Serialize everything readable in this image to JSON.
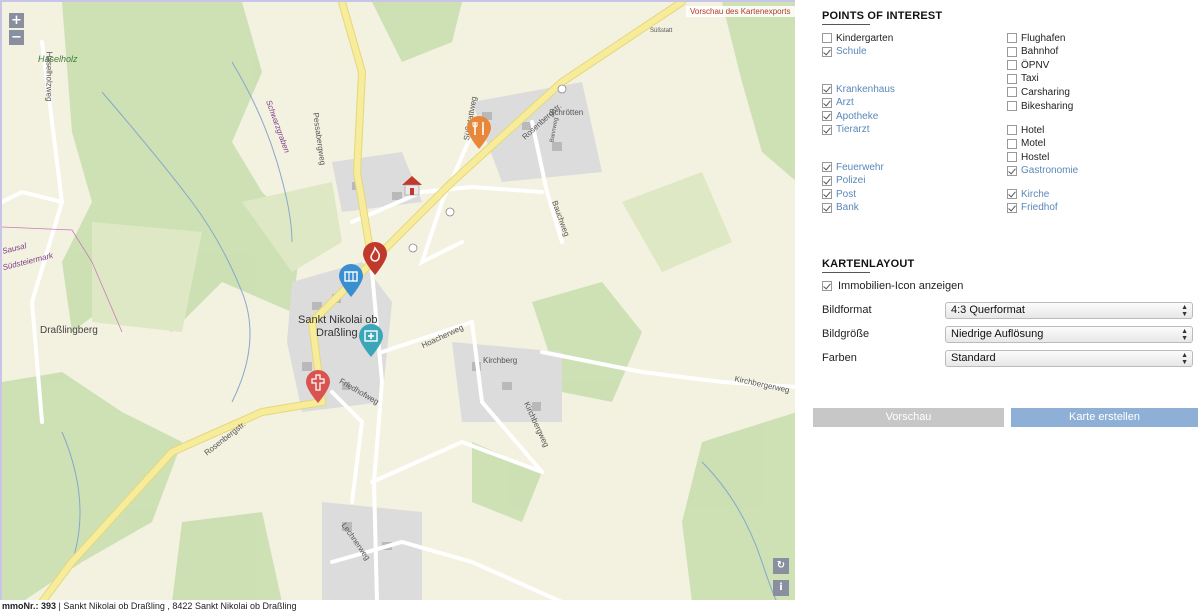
{
  "map": {
    "zoom_in": "+",
    "zoom_out": "−",
    "export_preview_label": "Vorschau des Kartenexports",
    "labels": {
      "haselholz": "Haselholz",
      "drasslingberg": "Draßlingberg",
      "sankt_nikolai": "Sankt Nikolai ob",
      "drassling": "Draßling",
      "schrotten": "Schrötten",
      "kirchberg": "Kirchberg",
      "pessabergweg": "Pessabergweg",
      "rosenbergstr_top": "Rosenbergstr.",
      "rosenbergstr_bottom": "Rosenbergstr.",
      "friedhofweg": "Friedhofweg",
      "hoacherweg": "Hoacherweg",
      "kirchbergweg": "Kirchbergweg",
      "kirchbergerweg": "Kirchbergerweg",
      "bauchweg": "Bauchweg",
      "sdstatt": "Süßstatt",
      "sesstattweg": "Süßstattweg",
      "bannweg": "Bannweg",
      "haselholzweg": "Haselholzweg",
      "lechnerweg": "Lechnerweg",
      "schwarzgraben": "Schwarzgraben",
      "suedsteiermark": "Südsteiermark",
      "sausal": "Sausal",
      "road_b": "B"
    },
    "refresh_icon": "↻",
    "info_icon": "i",
    "status_prefix": "mmoNr.: 393",
    "status_text": " | Sankt Nikolai ob Draßling , 8422 Sankt Nikolai ob Draßling"
  },
  "poi": {
    "title": "POINTS OF INTEREST",
    "left_groups": [
      [
        {
          "label": "Kindergarten",
          "checked": false
        },
        {
          "label": "Schule",
          "checked": true
        }
      ],
      [
        {
          "label": "Krankenhaus",
          "checked": true
        },
        {
          "label": "Arzt",
          "checked": true
        },
        {
          "label": "Apotheke",
          "checked": true
        },
        {
          "label": "Tierarzt",
          "checked": true
        }
      ],
      [
        {
          "label": "Feuerwehr",
          "checked": true
        },
        {
          "label": "Polizei",
          "checked": true
        },
        {
          "label": "Post",
          "checked": true
        },
        {
          "label": "Bank",
          "checked": true
        }
      ]
    ],
    "right_groups": [
      [
        {
          "label": "Flughafen",
          "checked": false
        },
        {
          "label": "Bahnhof",
          "checked": false
        },
        {
          "label": "ÖPNV",
          "checked": false
        },
        {
          "label": "Taxi",
          "checked": false
        },
        {
          "label": "Carsharing",
          "checked": false
        },
        {
          "label": "Bikesharing",
          "checked": false
        }
      ],
      [
        {
          "label": "Hotel",
          "checked": false
        },
        {
          "label": "Motel",
          "checked": false
        },
        {
          "label": "Hostel",
          "checked": false
        },
        {
          "label": "Gastronomie",
          "checked": true
        }
      ],
      [
        {
          "label": "Kirche",
          "checked": true
        },
        {
          "label": "Friedhof",
          "checked": true
        }
      ]
    ]
  },
  "layout": {
    "title": "KARTENLAYOUT",
    "show_icon_label": "Immobilien-Icon anzeigen",
    "show_icon_checked": true,
    "bildformat_label": "Bildformat",
    "bildformat_value": "4:3 Querformat",
    "bildgroesse_label": "Bildgröße",
    "bildgroesse_value": "Niedrige Auflösung",
    "farben_label": "Farben",
    "farben_value": "Standard"
  },
  "buttons": {
    "preview": "Vorschau",
    "create": "Karte erstellen"
  },
  "colors": {
    "checked_label": "#5a87b8",
    "preview_button": "#c7c7c7",
    "create_button": "#8fb0d6",
    "pin_fire": "#c0392b",
    "pin_school": "#3a8fd0",
    "pin_medical": "#3aa6b8",
    "pin_church": "#d9534f",
    "pin_gastro": "#e8873a"
  }
}
